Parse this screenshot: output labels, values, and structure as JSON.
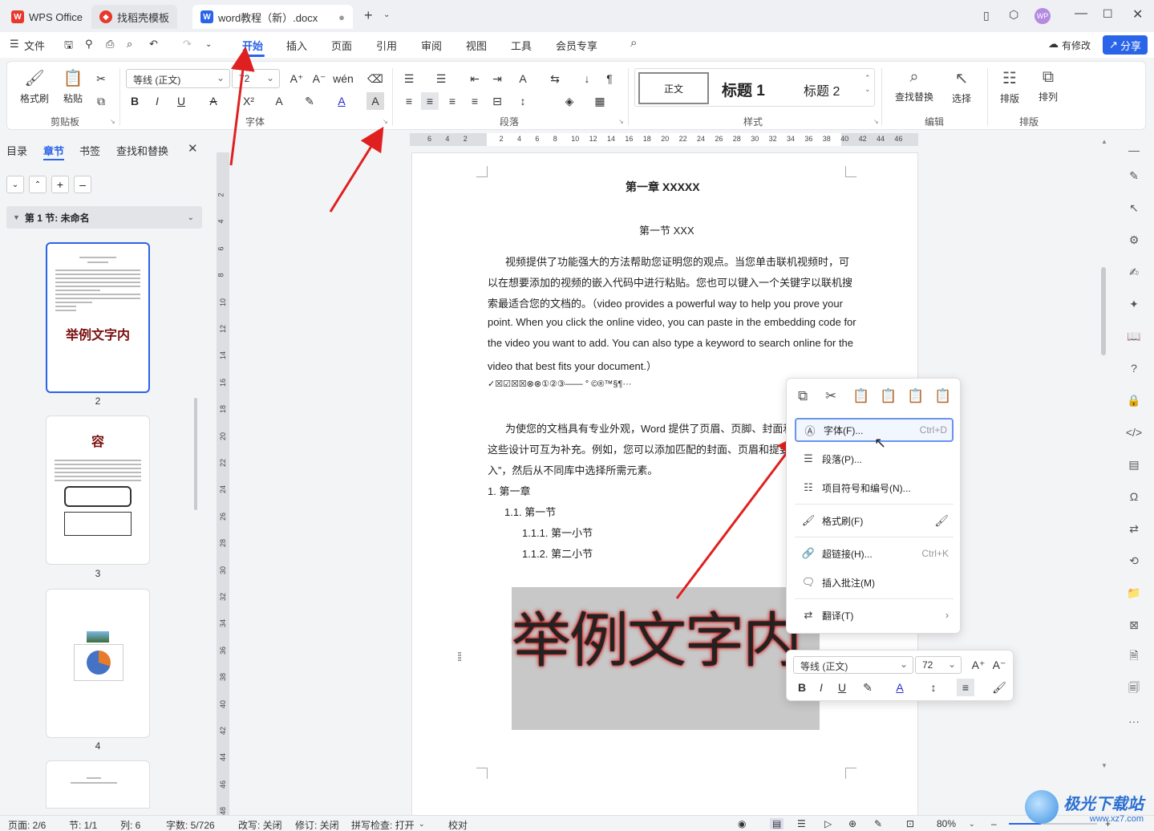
{
  "tabs": {
    "wps": "WPS Office",
    "template": "找稻壳模板",
    "doc": "word教程（新）.docx"
  },
  "menu": {
    "file": "文件",
    "start": "开始",
    "insert": "插入",
    "page": "页面",
    "ref": "引用",
    "review": "审阅",
    "view": "视图",
    "tools": "工具",
    "vip": "会员专享",
    "modified": "有修改",
    "share": "分享"
  },
  "ribbon": {
    "format_painter": "格式刷",
    "paste": "粘贴",
    "clipboard": "剪贴板",
    "font_name": "等线 (正文)",
    "font_size": "72",
    "font_group": "字体",
    "paragraph_group": "段落",
    "style_normal": "正文",
    "style_h1": "标题 1",
    "style_h2": "标题 2",
    "styles_group": "样式",
    "find_replace": "查找替换",
    "select": "选择",
    "edit_group": "编辑",
    "arrange": "排版",
    "sort": "排列",
    "arrange_group": "排版"
  },
  "nav": {
    "tabs": [
      "目录",
      "章节",
      "书签",
      "查找和替换"
    ],
    "section": "第 1 节: 未命名",
    "thumb_text_2": "举例文字内",
    "thumb_text_3": "容",
    "pages": [
      "2",
      "3",
      "4"
    ]
  },
  "ruler": {
    "h": [
      "6",
      "4",
      "2",
      "",
      "2",
      "4",
      "6",
      "8",
      "10",
      "12",
      "14",
      "16",
      "18",
      "20",
      "22",
      "24",
      "26",
      "28",
      "30",
      "32",
      "34",
      "36",
      "38",
      "40",
      "42",
      "44",
      "46"
    ],
    "v": [
      "2",
      "4",
      "6",
      "8",
      "10",
      "12",
      "14",
      "16",
      "18",
      "20",
      "22",
      "24",
      "26",
      "28",
      "30",
      "32",
      "34",
      "36",
      "38",
      "40",
      "42",
      "44",
      "46",
      "48"
    ]
  },
  "doc": {
    "chapter": "第一章  XXXXX",
    "section": "第一节  XXX",
    "p1": [
      "视频提供了功能强大的方法帮助您证明您的观点。当您单击联机视频时，可",
      "以在想要添加的视频的嵌入代码中进行粘贴。您也可以键入一个关键字以联机搜",
      "索最适合您的文档的。（video provides a powerful way to help you prove your",
      "point. When you click the online video, you can paste in the embedding code for",
      "the video you want to add. You can also type a keyword to search online for the",
      "video that best fits your document.）"
    ],
    "symbols": "✓☒☑☒☒⊗⊗①②③——   °  ©®™§¶···",
    "p2": [
      "为使您的文档具有专业外观，Word  提供了页眉、页脚、封面和",
      "这些设计可互为补充。例如，您可以添加匹配的封面、页眉和提要",
      "入”，然后从不同库中选择所需元素。"
    ],
    "list": [
      "1.   第一章",
      "1.1. 第一节",
      "1.1.1.   第一小节",
      "1.1.2.   第二小节"
    ],
    "big_text": "举例文字内"
  },
  "context": [
    {
      "label": "字体(F)...",
      "shortcut": "Ctrl+D"
    },
    {
      "label": "段落(P)...",
      "shortcut": ""
    },
    {
      "label": "项目符号和编号(N)...",
      "shortcut": ""
    },
    {
      "label": "格式刷(F)",
      "shortcut": ""
    },
    {
      "label": "超链接(H)...",
      "shortcut": "Ctrl+K"
    },
    {
      "label": "插入批注(M)",
      "shortcut": ""
    },
    {
      "label": "翻译(T)",
      "shortcut": ""
    }
  ],
  "mini": {
    "font": "等线 (正文)",
    "size": "72"
  },
  "status": {
    "page": "页面: 2/6",
    "section": "节: 1/1",
    "col": "列: 6",
    "words": "字数: 5/726",
    "revise": "改写: 关闭",
    "track": "修订: 关闭",
    "spell": "拼写检查: 打开",
    "proof": "校对",
    "zoom": "80%"
  },
  "watermark": "极光下载站",
  "watermark_url": "www.xz7.com",
  "colors": {
    "accent": "#2a64e8",
    "arrow": "#e02020",
    "wps_red": "#e8382b",
    "word_blue": "#2a64e8"
  }
}
